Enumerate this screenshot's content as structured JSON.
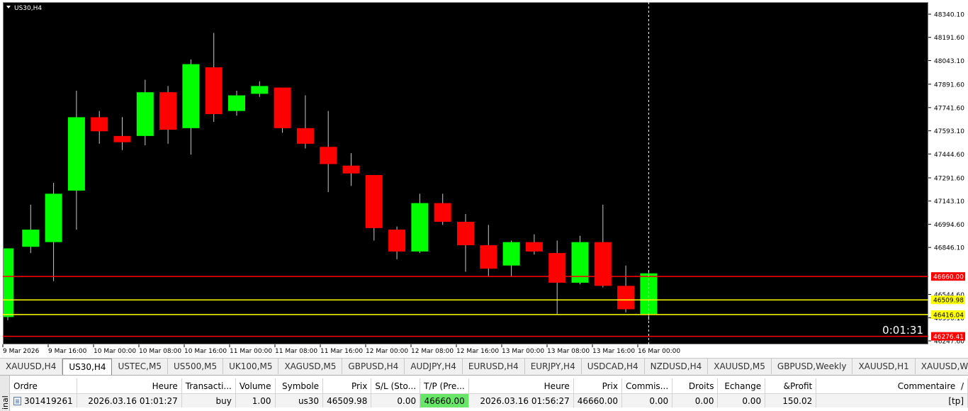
{
  "chart": {
    "symbol_label": "US30,H4",
    "countdown": "0:01:31",
    "colors": {
      "background": "#000000",
      "bull": "#00ff00",
      "bear": "#ff0000",
      "grid_line": "#ffffff",
      "sl_line": "#ff0000",
      "price_line": "#ffff00"
    },
    "price_axis_labels": [
      "48340.10",
      "48191.60",
      "48043.10",
      "47891.60",
      "47741.60",
      "47593.10",
      "47444.60",
      "47291.60",
      "47143.10",
      "46994.60",
      "46846.10",
      "46544.60",
      "46396.10",
      "46247.60"
    ],
    "level_tags": [
      {
        "text": "46660.00",
        "price": 46660,
        "color": "#ff0000",
        "text_color": "#ffffff"
      },
      {
        "text": "46509.98",
        "price": 46509.98,
        "color": "#ffff00",
        "text_color": "#000000"
      },
      {
        "text": "46416.04",
        "price": 46416.04,
        "color": "#ffff00",
        "text_color": "#000000"
      },
      {
        "text": "46276.41",
        "price": 46276.41,
        "color": "#ff0000",
        "text_color": "#ffffff"
      }
    ],
    "time_labels": [
      "9 Mar 2026",
      "9 Mar 16:00",
      "10 Mar 00:00",
      "10 Mar 08:00",
      "10 Mar 16:00",
      "11 Mar 00:00",
      "11 Mar 08:00",
      "11 Mar 16:00",
      "12 Mar 00:00",
      "12 Mar 08:00",
      "12 Mar 16:00",
      "13 Mar 00:00",
      "13 Mar 08:00",
      "13 Mar 16:00",
      "16 Mar 00:00"
    ]
  },
  "chart_data": {
    "type": "candlestick",
    "title": "US30,H4",
    "y_range": [
      46230,
      48390
    ],
    "candles": [
      {
        "o": 46400,
        "h": 46840,
        "l": 46380,
        "c": 46840
      },
      {
        "o": 46850,
        "h": 47120,
        "l": 46810,
        "c": 46960
      },
      {
        "o": 46880,
        "h": 47260,
        "l": 46630,
        "c": 47190
      },
      {
        "o": 47210,
        "h": 47850,
        "l": 46960,
        "c": 47680
      },
      {
        "o": 47680,
        "h": 47720,
        "l": 47510,
        "c": 47590
      },
      {
        "o": 47560,
        "h": 47680,
        "l": 47470,
        "c": 47520
      },
      {
        "o": 47560,
        "h": 47920,
        "l": 47500,
        "c": 47840
      },
      {
        "o": 47840,
        "h": 47880,
        "l": 47510,
        "c": 47600
      },
      {
        "o": 47610,
        "h": 48050,
        "l": 47440,
        "c": 48020
      },
      {
        "o": 48000,
        "h": 48220,
        "l": 47650,
        "c": 47700
      },
      {
        "o": 47720,
        "h": 47850,
        "l": 47690,
        "c": 47820
      },
      {
        "o": 47830,
        "h": 47910,
        "l": 47810,
        "c": 47880
      },
      {
        "o": 47870,
        "h": 47870,
        "l": 47580,
        "c": 47610
      },
      {
        "o": 47610,
        "h": 47820,
        "l": 47480,
        "c": 47510
      },
      {
        "o": 47490,
        "h": 47720,
        "l": 47200,
        "c": 47380
      },
      {
        "o": 47370,
        "h": 47450,
        "l": 47240,
        "c": 47320
      },
      {
        "o": 47310,
        "h": 47310,
        "l": 46890,
        "c": 46970
      },
      {
        "o": 46960,
        "h": 46980,
        "l": 46770,
        "c": 46820
      },
      {
        "o": 46820,
        "h": 47190,
        "l": 46810,
        "c": 47130
      },
      {
        "o": 47130,
        "h": 47190,
        "l": 46990,
        "c": 47010
      },
      {
        "o": 47010,
        "h": 47060,
        "l": 46690,
        "c": 46860
      },
      {
        "o": 46860,
        "h": 46990,
        "l": 46660,
        "c": 46710
      },
      {
        "o": 46730,
        "h": 46890,
        "l": 46660,
        "c": 46880
      },
      {
        "o": 46880,
        "h": 46930,
        "l": 46800,
        "c": 46820
      },
      {
        "o": 46810,
        "h": 46890,
        "l": 46420,
        "c": 46620
      },
      {
        "o": 46620,
        "h": 46920,
        "l": 46610,
        "c": 46880
      },
      {
        "o": 46880,
        "h": 47120,
        "l": 46590,
        "c": 46600
      },
      {
        "o": 46600,
        "h": 46730,
        "l": 46430,
        "c": 46450
      },
      {
        "o": 46420,
        "h": 46690,
        "l": 46380,
        "c": 46680
      }
    ]
  },
  "tabs": [
    {
      "label": "XAUUSD,H4",
      "active": false
    },
    {
      "label": "US30,H4",
      "active": true
    },
    {
      "label": "USTEC,M5",
      "active": false
    },
    {
      "label": "US500,M5",
      "active": false
    },
    {
      "label": "UK100,M5",
      "active": false
    },
    {
      "label": "XAGUSD,M5",
      "active": false
    },
    {
      "label": "GBPUSD,H4",
      "active": false
    },
    {
      "label": "AUDJPY,H4",
      "active": false
    },
    {
      "label": "EURUSD,H4",
      "active": false
    },
    {
      "label": "EURJPY,H4",
      "active": false
    },
    {
      "label": "USDCAD,H4",
      "active": false
    },
    {
      "label": "NZDUSD,H4",
      "active": false
    },
    {
      "label": "XAUUSD,M5",
      "active": false
    },
    {
      "label": "GBPUSD,Weekly",
      "active": false
    },
    {
      "label": "XAUUSD,H1",
      "active": false
    },
    {
      "label": "XAUUSD,W",
      "active": false
    }
  ],
  "terminal": {
    "side_label": "inal",
    "columns": [
      "Ordre",
      "Heure",
      "Transacti...",
      "Volume",
      "Symbole",
      "Prix",
      "S/L (Sto...",
      "T/P (Pre...",
      "Heure",
      "Prix",
      "Commis...",
      "Droits",
      "Echange",
      "&Profit",
      "Commentaire"
    ],
    "sort_indicator": "/",
    "row": {
      "ordre": "301419261",
      "heure": "2026.03.16 01:01:27",
      "transaction": "buy",
      "volume": "1.00",
      "symbole": "us30",
      "prix": "46509.98",
      "sl": "0.00",
      "tp": "46660.00",
      "heure2": "2026.03.16 01:56:27",
      "prix2": "46660.00",
      "commission": "0.00",
      "droits": "0.00",
      "echange": "0.00",
      "profit": "150.02",
      "commentaire": "[tp]"
    }
  }
}
